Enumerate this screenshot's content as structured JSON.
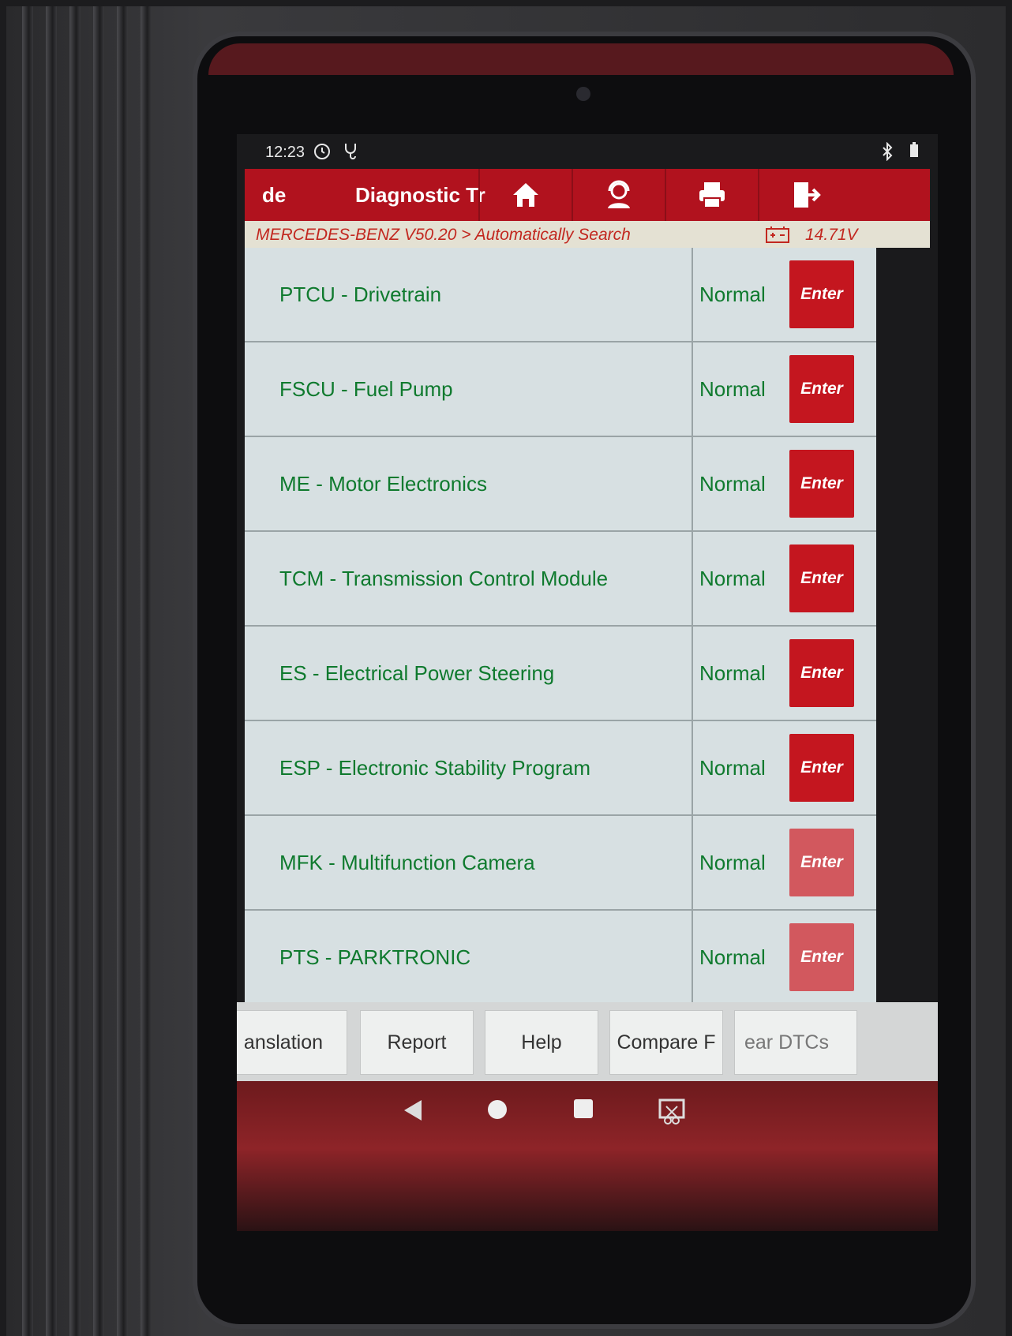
{
  "status_bar": {
    "time": "12:23",
    "icons": [
      "clock-cog-icon",
      "stethoscope-icon",
      "bluetooth-icon",
      "battery-icon"
    ]
  },
  "app_bar": {
    "left_label": "de",
    "title": "Diagnostic Tr",
    "buttons": [
      "home-icon",
      "user-support-icon",
      "printer-icon",
      "exit-icon"
    ],
    "color": "#b1121e"
  },
  "breadcrumb": {
    "path": "MERCEDES-BENZ V50.20 > Automatically Search",
    "voltage": "14.71V"
  },
  "systems": [
    {
      "name": "PTCU - Drivetrain",
      "status": "Normal",
      "action": "Enter"
    },
    {
      "name": "FSCU - Fuel Pump",
      "status": "Normal",
      "action": "Enter"
    },
    {
      "name": "ME - Motor Electronics",
      "status": "Normal",
      "action": "Enter"
    },
    {
      "name": "TCM - Transmission Control Module",
      "status": "Normal",
      "action": "Enter"
    },
    {
      "name": "ES - Electrical Power Steering",
      "status": "Normal",
      "action": "Enter"
    },
    {
      "name": "ESP - Electronic Stability Program",
      "status": "Normal",
      "action": "Enter"
    },
    {
      "name": "MFK - Multifunction Camera",
      "status": "Normal",
      "action": "Enter"
    },
    {
      "name": "PTS - PARKTRONIC",
      "status": "Normal",
      "action": "Enter"
    }
  ],
  "toolbar": {
    "buttons": [
      "anslation",
      "Report",
      "Help",
      "Compare F",
      "ear DTCs"
    ]
  },
  "nav_bar": {
    "icons": [
      "back-icon",
      "home-circle-icon",
      "recents-icon",
      "screenshot-icon"
    ]
  },
  "colors": {
    "accent_red": "#c4161f",
    "status_green": "#0f7a2e",
    "row_bg": "#d7e0e2"
  }
}
